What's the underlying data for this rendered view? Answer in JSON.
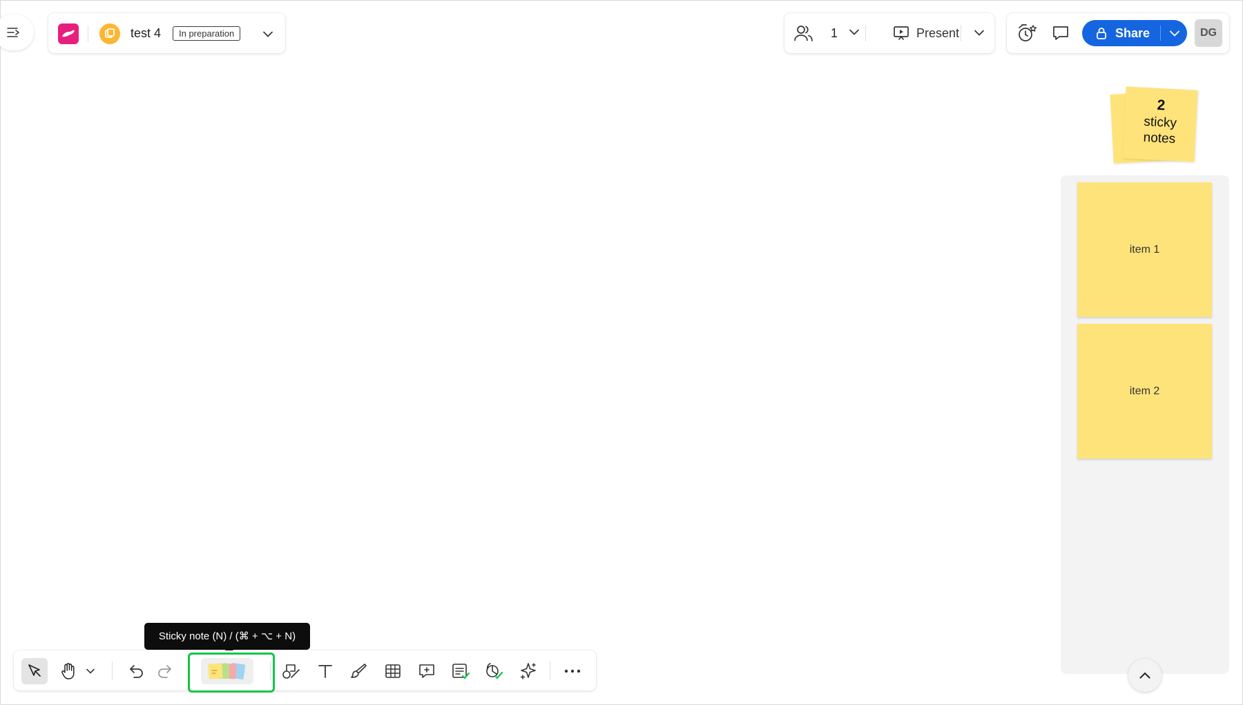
{
  "header": {
    "board_name": "test 4",
    "board_status": "In preparation",
    "app_logo_color": "#e81e7f",
    "board_icon_color": "#fcb630"
  },
  "collaboration": {
    "users_count": "1",
    "present_label": "Present"
  },
  "actions": {
    "share_label": "Share",
    "share_color": "#1565e0",
    "avatar_initials": "DG"
  },
  "canvas": {
    "stack": {
      "count": "2",
      "label": "sticky notes"
    },
    "notes": [
      {
        "text": "item 1"
      },
      {
        "text": "item 2"
      }
    ],
    "note_color": "#fee37b"
  },
  "tooltip": {
    "text": "Sticky note (N) / (⌘ + ⌥ + N)"
  },
  "toolbar": {
    "tools": [
      "select-icon",
      "hand-icon",
      "undo-icon",
      "redo-icon",
      "sticky-note-icon",
      "shapes-icon",
      "text-icon",
      "pen-icon",
      "table-icon",
      "comment-icon",
      "card-icon",
      "timeline-icon",
      "ai-sparkle-icon",
      "more-icon"
    ],
    "highlight_color": "#12c44a"
  }
}
